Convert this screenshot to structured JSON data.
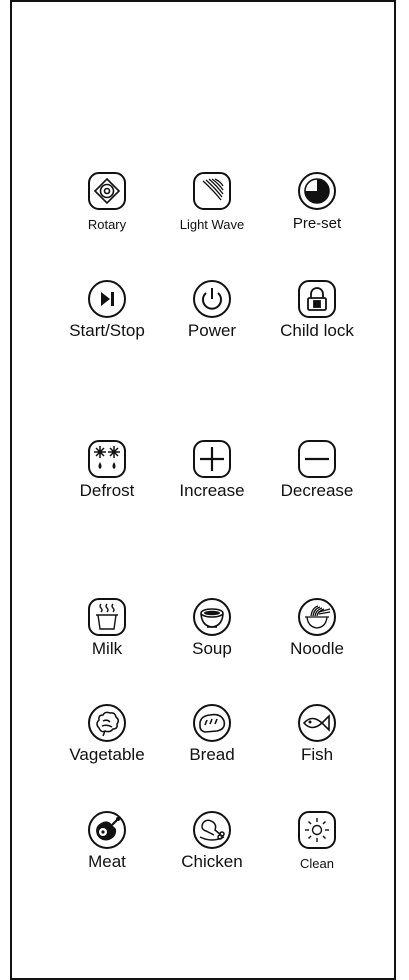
{
  "buttons": {
    "rotary": "Rotary",
    "light_wave": "Light Wave",
    "preset": "Pre-set",
    "start_stop": "Start/Stop",
    "power": "Power",
    "child_lock": "Child lock",
    "defrost": "Defrost",
    "increase": "Increase",
    "decrease": "Decrease",
    "milk": "Milk",
    "soup": "Soup",
    "noodle": "Noodle",
    "vegetable": "Vagetable",
    "bread": "Bread",
    "fish": "Fish",
    "meat": "Meat",
    "chicken": "Chicken",
    "clean": "Clean"
  },
  "icons": {
    "rotary": "rotary-icon",
    "light_wave": "light-wave-icon",
    "preset": "preset-timer-icon",
    "start_stop": "play-pause-icon",
    "power": "power-icon",
    "child_lock": "lock-icon",
    "defrost": "snowflake-droplet-icon",
    "increase": "plus-icon",
    "decrease": "minus-icon",
    "milk": "steaming-cup-icon",
    "soup": "bowl-icon",
    "noodle": "noodle-bowl-icon",
    "vegetable": "vegetable-icon",
    "bread": "bread-icon",
    "fish": "fish-icon",
    "meat": "ham-icon",
    "chicken": "drumstick-icon",
    "clean": "sun-sparkle-icon"
  }
}
